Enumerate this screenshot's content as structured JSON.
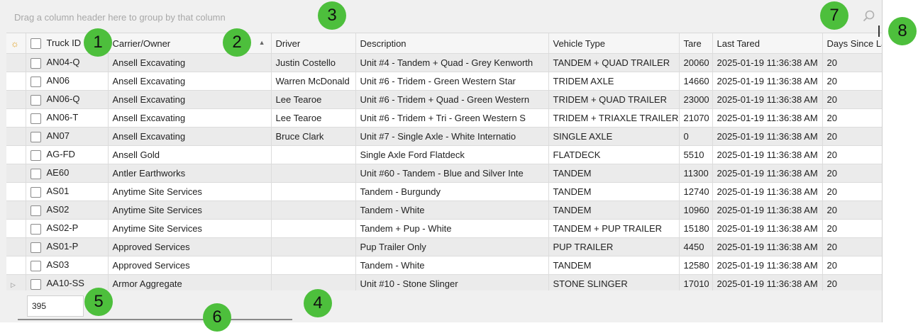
{
  "group_panel": {
    "hint": "Drag a column header here to group by that column"
  },
  "icons": {
    "settings": "sun-settings-icon",
    "search": "search-icon",
    "sort": "sort-asc-icon",
    "row_indicator": "row-expand-icon"
  },
  "columns": [
    "Truck ID",
    "Carrier/Owner",
    "Driver",
    "Description",
    "Vehicle Type",
    "Tare",
    "Last Tared",
    "Days Since La"
  ],
  "rows": [
    [
      "AN04-Q",
      "Ansell Excavating",
      "Justin Costello",
      "Unit #4 - Tandem + Quad - Grey Kenworth",
      "TANDEM + QUAD TRAILER",
      "20060",
      "2025-01-19 11:36:38 AM",
      "20"
    ],
    [
      "AN06",
      "Ansell Excavating",
      "Warren McDonald",
      "Unit #6 - Tridem - Green Western Star",
      "TRIDEM AXLE",
      "14660",
      "2025-01-19 11:36:38 AM",
      "20"
    ],
    [
      "AN06-Q",
      "Ansell Excavating",
      "Lee Tearoe",
      "Unit #6 - Tridem + Quad - Green Western",
      "TRIDEM + QUAD TRAILER",
      "23000",
      "2025-01-19 11:36:38 AM",
      "20"
    ],
    [
      "AN06-T",
      "Ansell Excavating",
      "Lee Tearoe",
      "Unit #6 - Tridem + Tri - Green Western S",
      "TRIDEM + TRIAXLE TRAILER",
      "21070",
      "2025-01-19 11:36:38 AM",
      "20"
    ],
    [
      "AN07",
      "Ansell Excavating",
      "Bruce Clark",
      "Unit #7 - Single Axle - White Internatio",
      "SINGLE AXLE",
      "0",
      "2025-01-19 11:36:38 AM",
      "20"
    ],
    [
      "AG-FD",
      "Ansell Gold",
      "",
      "Single Axle Ford Flatdeck",
      "FLATDECK",
      "5510",
      "2025-01-19 11:36:38 AM",
      "20"
    ],
    [
      "AE60",
      "Antler Earthworks",
      "",
      "Unit #60 - Tandem - Blue and Silver Inte",
      "TANDEM",
      "11300",
      "2025-01-19 11:36:38 AM",
      "20"
    ],
    [
      "AS01",
      "Anytime Site Services",
      "",
      "Tandem - Burgundy",
      "TANDEM",
      "12740",
      "2025-01-19 11:36:38 AM",
      "20"
    ],
    [
      "AS02",
      "Anytime Site Services",
      "",
      "Tandem - White",
      "TANDEM",
      "10960",
      "2025-01-19 11:36:38 AM",
      "20"
    ],
    [
      "AS02-P",
      "Anytime Site Services",
      "",
      "Tandem + Pup - White",
      "TANDEM + PUP TRAILER",
      "15180",
      "2025-01-19 11:36:38 AM",
      "20"
    ],
    [
      "AS01-P",
      "Approved Services",
      "",
      "Pup Trailer Only",
      "PUP TRAILER",
      "4450",
      "2025-01-19 11:36:38 AM",
      "20"
    ],
    [
      "AS03",
      "Approved Services",
      "",
      "Tandem - White",
      "TANDEM",
      "12580",
      "2025-01-19 11:36:38 AM",
      "20"
    ],
    [
      "AA10-SS",
      "Armor Aggregate",
      "",
      "Unit #10 - Stone Slinger",
      "STONE SLINGER",
      "17010",
      "2025-01-19 11:36:38 AM",
      "20"
    ]
  ],
  "footer": {
    "count": "395"
  },
  "callouts": [
    "1",
    "2",
    "3",
    "4",
    "5",
    "6",
    "7",
    "8"
  ],
  "colors": {
    "callout": "#4dbf3c",
    "alt_row": "#ebebeb",
    "header_bg": "#f6f6f6",
    "panel_bg": "#f0f0f0"
  }
}
